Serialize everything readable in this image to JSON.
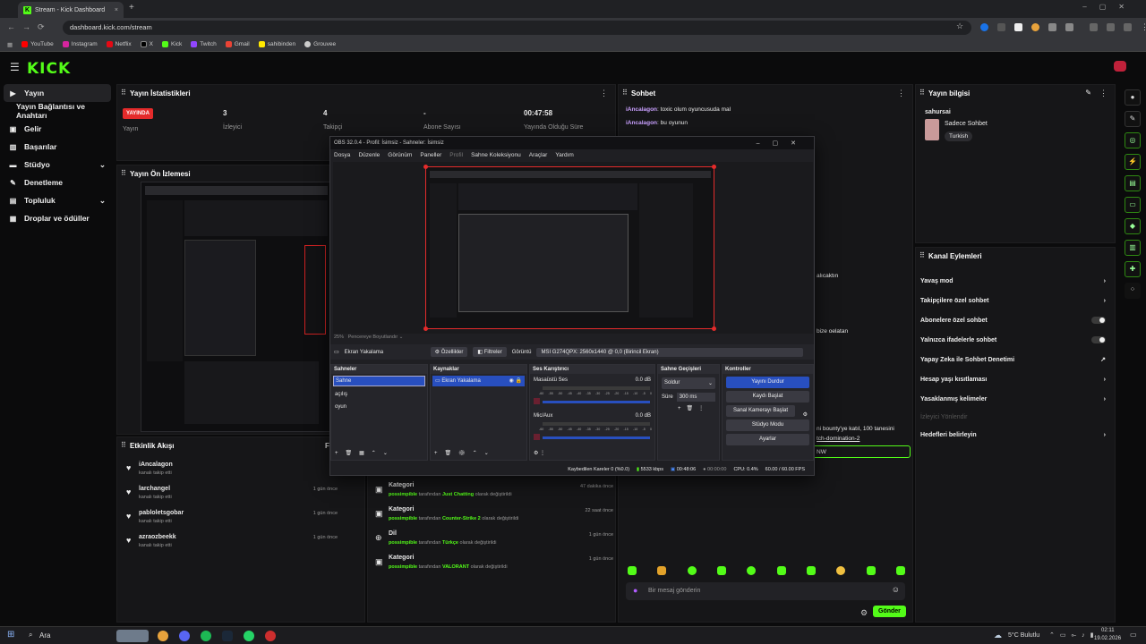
{
  "browser": {
    "tab_title": "Stream - Kick Dashboard",
    "url": "dashboard.kick.com/stream",
    "bookmarks": [
      "YouTube",
      "Instagram",
      "Netflix",
      "X",
      "Kick",
      "Twitch",
      "Gmail",
      "sahibinden",
      "Grouvee"
    ]
  },
  "brand": {
    "logo": "KICK",
    "accent": "#53fc18"
  },
  "sidebar": {
    "items": [
      {
        "label": "Yayın",
        "icon": "play-icon"
      },
      {
        "label": "Yayın Bağlantısı ve Anahtarı",
        "icon": ""
      },
      {
        "label": "Gelir",
        "icon": "money-icon"
      },
      {
        "label": "Başarılar",
        "icon": "trophy-icon"
      },
      {
        "label": "Stüdyo",
        "icon": "studio-icon"
      },
      {
        "label": "Denetleme",
        "icon": "wrench-icon"
      },
      {
        "label": "Topluluk",
        "icon": "people-icon"
      },
      {
        "label": "Droplar ve ödüller",
        "icon": "gift-icon"
      }
    ]
  },
  "stats": {
    "title": "Yayın İstatistikleri",
    "status_badge": "YAYINDA",
    "status_label": "Yayın",
    "viewers": "3",
    "viewers_label": "İzleyici",
    "followers": "4",
    "followers_label": "Takipçi",
    "subs": "-",
    "subs_label": "Abone Sayısı",
    "uptime": "00:47:58",
    "uptime_label": "Yayında Olduğu Süre"
  },
  "preview": {
    "title": "Yayın Ön İzlemesi"
  },
  "activity": {
    "title": "Etkinlik Akışı",
    "filter": "Fi",
    "items": [
      {
        "name": "iAncalagon",
        "desc": "kanalı takip etti",
        "time": ""
      },
      {
        "name": "larchangel",
        "desc": "kanalı takip etti",
        "time": "1 gün önce"
      },
      {
        "name": "pabloletsgobar",
        "desc": "kanalı takip etti",
        "time": "1 gün önce"
      },
      {
        "name": "azraozbeekk",
        "desc": "kanalı takip etti",
        "time": "1 gün önce"
      }
    ]
  },
  "history": {
    "items": [
      {
        "title": "Kategori",
        "user": "possimpible",
        "mid": "tarafından",
        "value": "Just Chatting",
        "end": "olarak değiştirildi",
        "time": "47 dakika önce"
      },
      {
        "title": "Kategori",
        "user": "possimpible",
        "mid": "tarafından",
        "value": "Counter-Strike 2",
        "end": "olarak değiştirildi",
        "time": "22 saat önce"
      },
      {
        "title": "Dil",
        "user": "possimpible",
        "mid": "tarafından",
        "value": "Türkçe",
        "end": "olarak değiştirildi",
        "time": "1 gün önce"
      },
      {
        "title": "Kategori",
        "user": "possimpible",
        "mid": "tarafından",
        "value": "VALORANT",
        "end": "olarak değiştirildi",
        "time": "1 gün önce"
      }
    ]
  },
  "chat": {
    "title": "Sohbet",
    "messages": [
      {
        "user": "iAncalagon",
        "text": "toxic olum oyuncusuda mal"
      },
      {
        "user": "iAncalagon",
        "text": "bu oyunun"
      }
    ],
    "fragments": [
      "alıcaktın",
      "bize oelatan",
      "ni bounty'ye katıl, 100 tanesini",
      "tch-domination-2",
      "NW"
    ],
    "input_placeholder": "Bir mesaj gönderin",
    "send_label": "Gönder"
  },
  "info": {
    "title": "Yayın bilgisi",
    "user": "sahursai",
    "category": "Sadece Sohbet",
    "tag": "Turkish"
  },
  "actions": {
    "title": "Kanal Eylemleri",
    "items": [
      {
        "label": "Yavaş mod",
        "ctrl": "arrow"
      },
      {
        "label": "Takipçilere özel sohbet",
        "ctrl": "arrow"
      },
      {
        "label": "Abonelere özel sohbet",
        "ctrl": "toggle"
      },
      {
        "label": "Yalnızca ifadelerle sohbet",
        "ctrl": "toggle"
      },
      {
        "label": "Yapay Zeka ile Sohbet Denetimi",
        "ctrl": "ext"
      },
      {
        "label": "Hesap yaşı kısıtlaması",
        "ctrl": "arrow"
      },
      {
        "label": "Yasaklanmış kelimeler",
        "ctrl": "arrow"
      },
      {
        "label": "İzleyici Yönlendir",
        "ctrl": "none"
      },
      {
        "label": "Hedefleri belirleyin",
        "ctrl": "arrow"
      }
    ]
  },
  "obs": {
    "title": "OBS 32.0.4 - Profil: İsimsiz - Sahneler: İsimsiz",
    "menu": [
      "Dosya",
      "Düzenle",
      "Görünüm",
      "Paneller",
      "Profil",
      "Sahne Koleksiyonu",
      "Araçlar",
      "Yardım"
    ],
    "zoom": "25%",
    "fit": "Pencereye Boyutlandır",
    "source_name": "Ekran Yakalama",
    "props": "Özellikler",
    "filters": "Filtreler",
    "display_label": "Görüntü",
    "display_value": "MSI G274QPX: 2560x1440 @ 0,0 (Birincil Ekran)",
    "scenes_title": "Sahneler",
    "scenes": [
      "Sahne",
      "açılış",
      "oyun"
    ],
    "sources_title": "Kaynaklar",
    "sources": [
      "Ekran Yakalama"
    ],
    "mixer_title": "Ses Karıştırıcı",
    "mixer": [
      {
        "name": "Masaüstü Ses",
        "db": "0.0 dB"
      },
      {
        "name": "Mic/Aux",
        "db": "0.0 dB"
      }
    ],
    "scale": [
      "-60",
      "-55",
      "-50",
      "-45",
      "-40",
      "-35",
      "-30",
      "-25",
      "-20",
      "-15",
      "-10",
      "-5",
      "0"
    ],
    "trans_title": "Sahne Geçişleri",
    "trans_value": "Soldur",
    "duration_label": "Süre",
    "duration_value": "300 ms",
    "controls_title": "Kontroller",
    "controls": [
      "Yayını Durdur",
      "Kaydı Başlat",
      "Sanal Kamerayı Başlat",
      "Stüdyo Modu",
      "Ayarlar"
    ],
    "status": {
      "dropped": "Kaybedilen Kareler 0 (%0.0)",
      "kbps": "5533 kbps",
      "live": "00:48:06",
      "rec": "00:00:00",
      "cpu": "CPU: 0.4%",
      "fps": "60.00 / 60.00 FPS"
    }
  },
  "taskbar": {
    "search": "Ara",
    "weather": "5°C Bulutlu",
    "time": "02:11",
    "date": "19.02.2026"
  }
}
